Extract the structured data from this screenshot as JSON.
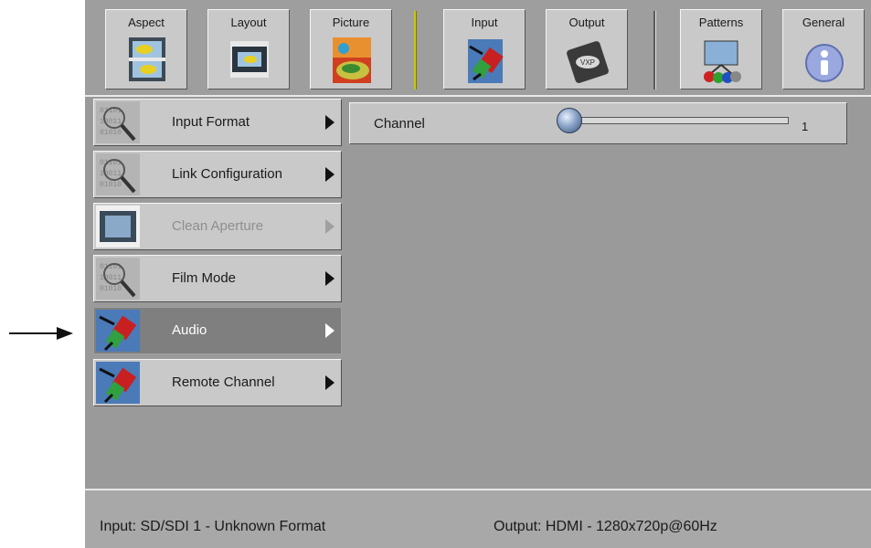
{
  "toolbar": {
    "items": [
      {
        "label": "Aspect",
        "icon": "aspect-icon"
      },
      {
        "label": "Layout",
        "icon": "layout-icon"
      },
      {
        "label": "Picture",
        "icon": "picture-icon"
      },
      {
        "label": "Input",
        "icon": "input-icon"
      },
      {
        "label": "Output",
        "icon": "output-icon"
      },
      {
        "label": "Patterns",
        "icon": "patterns-icon"
      },
      {
        "label": "General",
        "icon": "general-info-icon"
      }
    ]
  },
  "menu": {
    "items": [
      {
        "label": "Input Format",
        "icon": "magnifier-binary-icon",
        "state": "normal"
      },
      {
        "label": "Link Configuration",
        "icon": "magnifier-binary-icon",
        "state": "normal"
      },
      {
        "label": "Clean Aperture",
        "icon": "aperture-frame-icon",
        "state": "disabled"
      },
      {
        "label": "Film Mode",
        "icon": "magnifier-binary-icon",
        "state": "normal"
      },
      {
        "label": "Audio",
        "icon": "av-connector-icon",
        "state": "selected"
      },
      {
        "label": "Remote Channel",
        "icon": "av-connector-icon",
        "state": "normal"
      }
    ]
  },
  "channel": {
    "label": "Channel",
    "value": "1",
    "slider_fraction": 0.0
  },
  "status": {
    "input": "Input:   SD/SDI 1 - Unknown Format",
    "output": "Output: HDMI - 1280x720p@60Hz"
  },
  "colors": {
    "panel_bg": "#9a9a9a",
    "button_bg": "#c9c9c9",
    "selected_bg": "#7f7f7f",
    "disabled_text": "#8e8e8e"
  }
}
